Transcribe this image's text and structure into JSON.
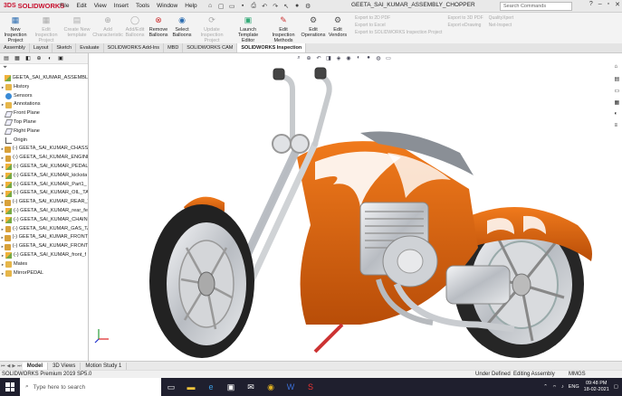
{
  "app": {
    "brand": "SOLIDWORKS",
    "brand_prefix": "3DS",
    "document_title": "GEETA_SAI_KUMAR_ASSEMBLY_CHOPPER",
    "search_placeholder": "Search Commands",
    "menu": [
      "File",
      "Edit",
      "View",
      "Insert",
      "Tools",
      "Window",
      "Help"
    ]
  },
  "commands": {
    "buttons": [
      {
        "label": "New Inspection Project",
        "enabled": true,
        "icon": "new-inspection-icon"
      },
      {
        "label": "Edit Inspection Project",
        "enabled": false,
        "icon": "edit-project-icon"
      },
      {
        "label": "Create New template",
        "enabled": false,
        "icon": "template-icon"
      },
      {
        "label": "Add Characteristic",
        "enabled": false,
        "icon": "characteristic-icon"
      },
      {
        "label": "Add/Edit Balloons",
        "enabled": false,
        "icon": "balloon-icon"
      },
      {
        "label": "Remove Balloons",
        "enabled": true,
        "icon": "remove-balloon-icon"
      },
      {
        "label": "Select Balloons",
        "enabled": true,
        "icon": "select-balloon-icon"
      },
      {
        "label": "Update Inspection Project",
        "enabled": false,
        "icon": "update-icon"
      },
      {
        "label": "Launch Template Editor",
        "enabled": true,
        "icon": "launch-editor-icon"
      },
      {
        "label": "Edit Inspection Methods",
        "enabled": true,
        "icon": "methods-icon"
      },
      {
        "label": "Edit Operations",
        "enabled": true,
        "icon": "operations-icon"
      },
      {
        "label": "Edit Vendors",
        "enabled": true,
        "icon": "vendors-icon"
      }
    ],
    "export_col1": [
      "Export to 2D PDF",
      "Export to Excel",
      "Export to SOLIDWORKS Inspection Project"
    ],
    "export_col2": [
      "Export to 3D PDF",
      "Export eDrawing"
    ],
    "export_col3": [
      "QualityXpert",
      "Net-Inspect"
    ]
  },
  "tabs": [
    "Assembly",
    "Layout",
    "Sketch",
    "Evaluate",
    "SOLIDWORKS Add-Ins",
    "MBD",
    "SOLIDWORKS CAM",
    "SOLIDWORKS Inspection"
  ],
  "active_tab": "SOLIDWORKS Inspection",
  "tree": {
    "root": "GEETA_SAI_KUMAR_ASSEMBLY_C",
    "items": [
      {
        "label": "History",
        "icon": "folder",
        "arrow": "▸"
      },
      {
        "label": "Sensors",
        "icon": "sensor",
        "arrow": ""
      },
      {
        "label": "Annotations",
        "icon": "folder",
        "arrow": "▸"
      },
      {
        "label": "Front Plane",
        "icon": "plane",
        "arrow": ""
      },
      {
        "label": "Top Plane",
        "icon": "plane",
        "arrow": ""
      },
      {
        "label": "Right Plane",
        "icon": "plane",
        "arrow": ""
      },
      {
        "label": "Origin",
        "icon": "origin",
        "arrow": ""
      },
      {
        "label": "(-) GEETA_SAI_KUMAR_CHASSIS<",
        "icon": "part",
        "arrow": "▸"
      },
      {
        "label": "(-) GEETA_SAI_KUMAR_ENGINE<",
        "icon": "part",
        "arrow": "▸"
      },
      {
        "label": "(-) GEETA_SAI_KUMAR_PEDAL",
        "icon": "asm",
        "arrow": "▸"
      },
      {
        "label": "(-) GEETA_SAI_KUMAR_kicksta",
        "icon": "asm",
        "arrow": "▸"
      },
      {
        "label": "(-) GEETA_SAI_KUMAR_Part1_",
        "icon": "asm",
        "arrow": "▸"
      },
      {
        "label": "(-) GEETA_SAI_KUMAR_OIL_TA",
        "icon": "asm",
        "arrow": "▸"
      },
      {
        "label": "(-) GEETA_SAI_KUMAR_REAR_WH",
        "icon": "part",
        "arrow": "▸"
      },
      {
        "label": "(-) GEETA_SAI_KUMAR_rear_fe",
        "icon": "asm",
        "arrow": "▸"
      },
      {
        "label": "(-) GEETA_SAI_KUMAR_CHAIN",
        "icon": "asm",
        "arrow": "▸"
      },
      {
        "label": "(-) GEETA_SAI_KUMAR_GAS_TAN",
        "icon": "part",
        "arrow": "▸"
      },
      {
        "label": "(-) GEETA_SAI_KUMAR_FRONT_FC",
        "icon": "part",
        "arrow": "▸"
      },
      {
        "label": "(-) GEETA_SAI_KUMAR_FRONT_W",
        "icon": "part",
        "arrow": "▸"
      },
      {
        "label": "(-) GEETA_SAI_KUMAR_front_f",
        "icon": "asm",
        "arrow": "▸"
      },
      {
        "label": "Mates",
        "icon": "folder",
        "arrow": "▸"
      },
      {
        "label": "MirrorPEDAL",
        "icon": "folder",
        "arrow": "▸"
      }
    ]
  },
  "bottom_tabs": [
    "Model",
    "3D Views",
    "Motion Study 1"
  ],
  "status": {
    "version": "SOLIDWORKS Premium 2019 SP5.0",
    "state1": "Under Defined",
    "state2": "Editing Assembly",
    "units": "MMGS"
  },
  "taskbar": {
    "search_placeholder": "Type here to search",
    "lang": "ENG",
    "time": "09:48 PM",
    "date": "18-02-2021"
  },
  "colors": {
    "body_orange": "#e06a12",
    "chrome": "#c9cbcf",
    "tire": "#2a2a2a",
    "brand_red": "#c8102e"
  }
}
